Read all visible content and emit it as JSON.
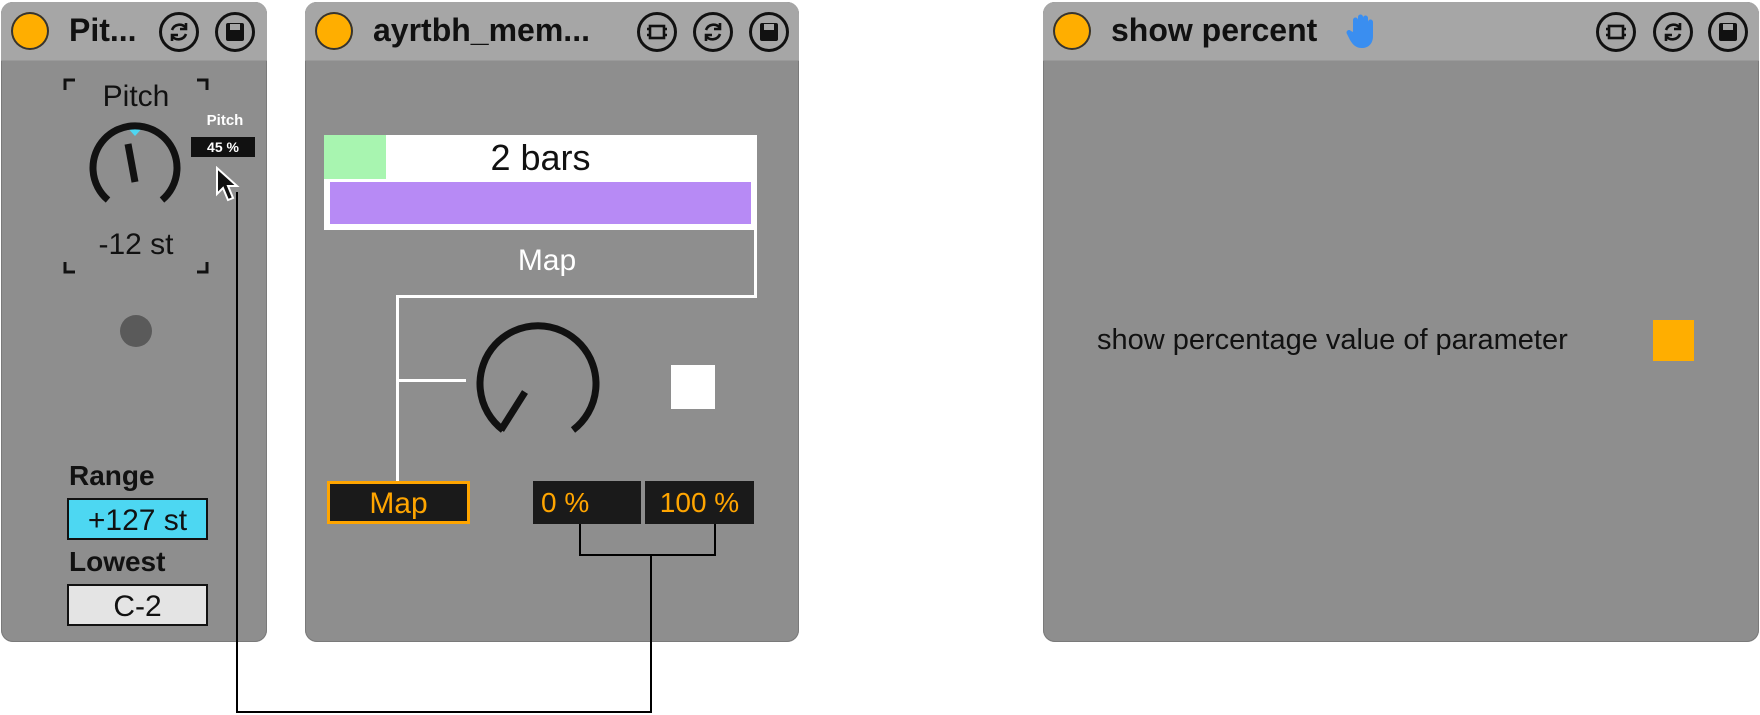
{
  "device1": {
    "title": "Pit...",
    "knob_label": "Pitch",
    "knob_value": "-12 st",
    "knob_level": 0.45,
    "tooltip_name": "Pitch",
    "tooltip_value": "45 %",
    "range_label": "Range",
    "range_value": "+127 st",
    "lowest_label": "Lowest",
    "lowest_value": "C-2"
  },
  "device2": {
    "title": "ayrtbh_mem...",
    "bar_text": "2 bars",
    "map_header": "Map",
    "map_button": "Map",
    "min_value": "0 %",
    "max_value": "100 %"
  },
  "device3": {
    "title": "show percent",
    "option_label": "show percentage value of parameter",
    "option_checked": true
  },
  "colors": {
    "accent": "#ffae00",
    "device_bg": "#8e8e8e",
    "titlebar_bg": "#a6a6a6",
    "range_highlight": "#4dd7f2",
    "progress_green": "#a8f5b0",
    "progress_purple": "#b78af5",
    "hand_blue": "#3a8ef0"
  },
  "icons": {
    "power": "power-toggle-icon",
    "refresh": "refresh-icon",
    "save": "save-icon",
    "freeze": "freeze-icon",
    "hand": "hand-icon",
    "cursor": "mouse-cursor-icon"
  }
}
